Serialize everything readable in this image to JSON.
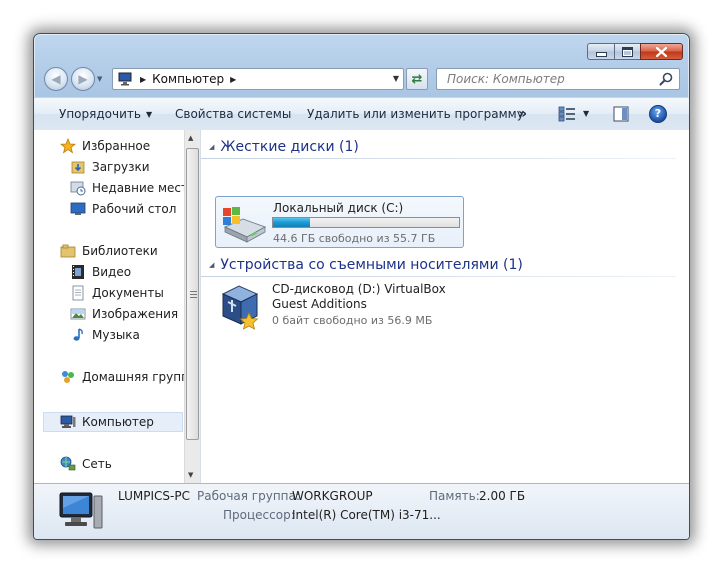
{
  "window": {
    "title": "Компьютер"
  },
  "address_bar": {
    "path": "Компьютер"
  },
  "search": {
    "placeholder": "Поиск: Компьютер"
  },
  "toolbar": {
    "organize": "Упорядочить",
    "system_properties": "Свойства системы",
    "uninstall": "Удалить или изменить программу",
    "more": "»"
  },
  "nav": {
    "favorites": "Избранное",
    "downloads": "Загрузки",
    "recent": "Недавние места",
    "desktop": "Рабочий стол",
    "libraries": "Библиотеки",
    "video": "Видео",
    "documents": "Документы",
    "pictures": "Изображения",
    "music": "Музыка",
    "homegroup": "Домашняя группа",
    "computer": "Компьютер",
    "network": "Сеть"
  },
  "groups": {
    "hard_disks": "Жесткие диски (1)",
    "removable": "Устройства со съемными носителями (1)"
  },
  "drives": {
    "c": {
      "name": "Локальный диск (C:)",
      "free": "44.6 ГБ свободно из 55.7 ГБ",
      "used_fraction": 0.2
    },
    "d": {
      "name": "CD-дисковод (D:) VirtualBox Guest Additions",
      "free": "0 байт свободно из 56.9 МБ"
    }
  },
  "details": {
    "pc_name": "LUMPICS-PC",
    "workgroup_label": "Рабочая группа:",
    "workgroup_value": "WORKGROUP",
    "memory_label": "Память:",
    "memory_value": "2.00 ГБ",
    "cpu_label": "Процессор:",
    "cpu_value": "Intel(R) Core(TM) i3-71..."
  },
  "colors": {
    "accent": "#1e3287",
    "selection": "#e5eef9",
    "progress": "#1a9ad4"
  }
}
